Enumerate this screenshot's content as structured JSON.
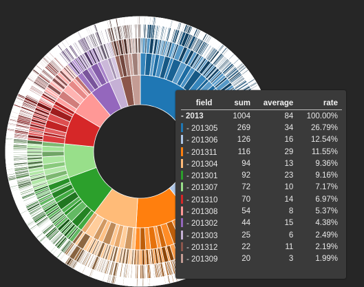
{
  "chart_data": {
    "type": "sunburst",
    "root": "2013",
    "total": 1004,
    "series": [
      {
        "name": "201305",
        "value": 269,
        "color": "#1f77b4"
      },
      {
        "name": "201306",
        "value": 126,
        "color": "#aec7e8"
      },
      {
        "name": "201311",
        "value": 116,
        "color": "#ff7f0e"
      },
      {
        "name": "201304",
        "value": 94,
        "color": "#ffbb78"
      },
      {
        "name": "201301",
        "value": 92,
        "color": "#2ca02c"
      },
      {
        "name": "201307",
        "value": 72,
        "color": "#98df8a"
      },
      {
        "name": "201310",
        "value": 70,
        "color": "#d62728"
      },
      {
        "name": "201308",
        "value": 54,
        "color": "#ff9896"
      },
      {
        "name": "201302",
        "value": 44,
        "color": "#9467bd"
      },
      {
        "name": "201303",
        "value": 25,
        "color": "#c5b0d5"
      },
      {
        "name": "201312",
        "value": 22,
        "color": "#8c564b"
      },
      {
        "name": "201309",
        "value": 20,
        "color": "#c49c94"
      }
    ]
  },
  "tooltip": {
    "headers": {
      "field": "field",
      "sum": "sum",
      "average": "average",
      "rate": "rate"
    },
    "total_row": {
      "label": "- 2013",
      "sum": "1004",
      "average": "84",
      "rate": "100.00%"
    },
    "rows": [
      {
        "label": "- 201305",
        "sum": "269",
        "average": "34",
        "rate": "26.79%",
        "color": "#1f77b4"
      },
      {
        "label": "- 201306",
        "sum": "126",
        "average": "16",
        "rate": "12.54%",
        "color": "#aec7e8"
      },
      {
        "label": "- 201311",
        "sum": "116",
        "average": "29",
        "rate": "11.55%",
        "color": "#ff7f0e"
      },
      {
        "label": "- 201304",
        "sum": "94",
        "average": "13",
        "rate": "9.36%",
        "color": "#ffbb78"
      },
      {
        "label": "- 201301",
        "sum": "92",
        "average": "23",
        "rate": "9.16%",
        "color": "#2ca02c"
      },
      {
        "label": "- 201307",
        "sum": "72",
        "average": "10",
        "rate": "7.17%",
        "color": "#98df8a"
      },
      {
        "label": "- 201310",
        "sum": "70",
        "average": "14",
        "rate": "6.97%",
        "color": "#d62728"
      },
      {
        "label": "- 201308",
        "sum": "54",
        "average": "8",
        "rate": "5.37%",
        "color": "#ff9896"
      },
      {
        "label": "- 201302",
        "sum": "44",
        "average": "15",
        "rate": "4.38%",
        "color": "#9467bd"
      },
      {
        "label": "- 201303",
        "sum": "25",
        "average": "6",
        "rate": "2.49%",
        "color": "#c5b0d5"
      },
      {
        "label": "- 201312",
        "sum": "22",
        "average": "11",
        "rate": "2.19%",
        "color": "#8c564b"
      },
      {
        "label": "- 201309",
        "sum": "20",
        "average": "3",
        "rate": "1.99%",
        "color": "#c49c94"
      }
    ]
  }
}
